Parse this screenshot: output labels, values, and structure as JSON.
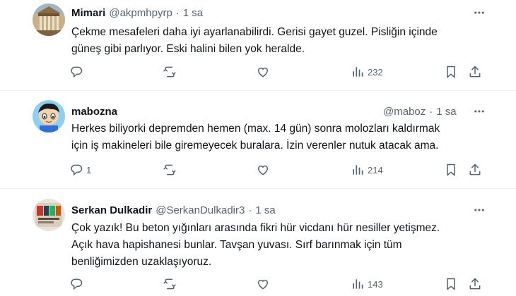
{
  "tweets": [
    {
      "name": "Mimari",
      "handle": "@akpmhpyrp",
      "separator": "·",
      "time": "1 sa",
      "text": [
        "Çekme mesafeleri daha iyi ayarlanabilirdi. Gerisi gayet guzel. Pisliğin içinde",
        "güneş gibi parlıyor. Eski halini bilen yok heralde."
      ],
      "replies": "",
      "retweets": "",
      "likes": "",
      "views": "232"
    },
    {
      "name": "mabozna",
      "handle": "@maboz",
      "separator": "·",
      "time": "1 sa",
      "text": [
        "Herkes biliyorki depremden hemen (max. 14 gün) sonra molozları kaldırmak",
        "için iş makineleri bile giremeyecek buralara. İzin verenler nutuk atacak ama."
      ],
      "replies": "1",
      "retweets": "",
      "likes": "",
      "views": "214"
    },
    {
      "name": "Serkan Dulkadir",
      "handle": "@SerkanDulkadir3",
      "separator": "·",
      "time": "1 sa",
      "text": [
        "Çok yazık! Bu beton yığınları arasında fikri hür vicdanı hür nesiller yetişmez.",
        "Açık hava hapishanesi bunlar. Tavşan yuvası. Sırf barınmak için tüm",
        "benliğimizden uzaklaşıyoruz."
      ],
      "replies": "",
      "retweets": "",
      "likes": "",
      "views": "143"
    }
  ],
  "colors": {
    "text": "#0f1419",
    "muted": "#536471",
    "divider": "#eff3f4"
  },
  "icons": [
    "reply-icon",
    "retweet-icon",
    "like-icon",
    "views-icon",
    "bookmark-icon",
    "share-icon",
    "more-icon"
  ]
}
